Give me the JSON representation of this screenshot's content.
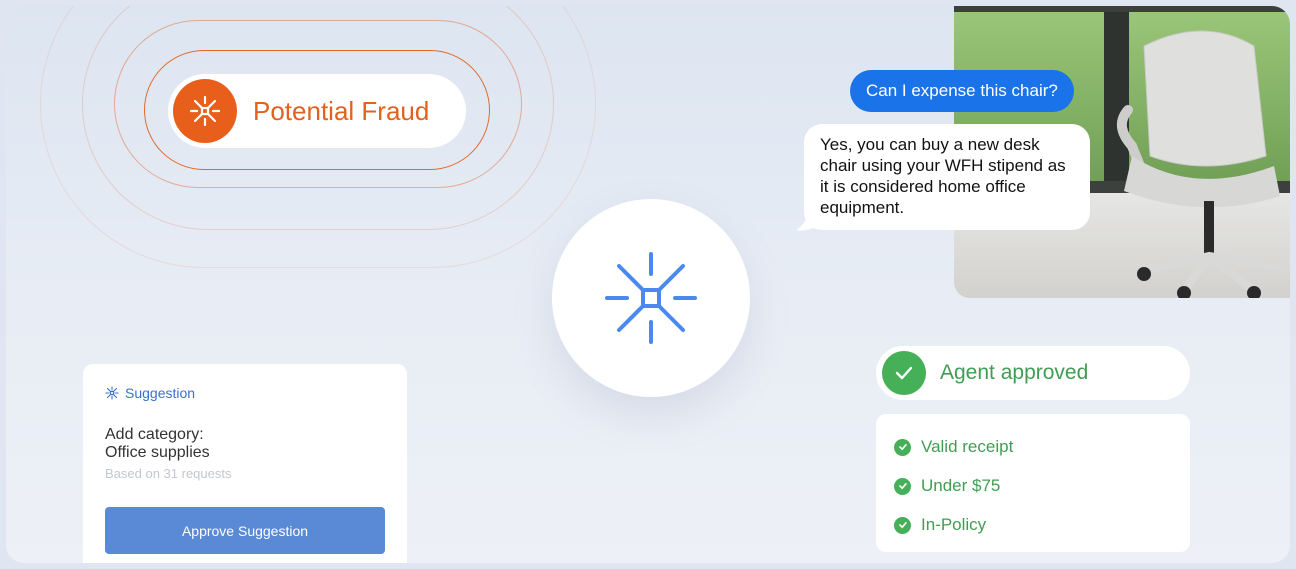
{
  "fraud": {
    "label": "Potential Fraud",
    "icon": "sparkle-icon",
    "color": "#e85f1c"
  },
  "center": {
    "icon": "sparkle-icon",
    "color": "#4a8af0"
  },
  "chat": {
    "user_message": "Can I expense this chair?",
    "agent_reply": "Yes, you can buy a new desk chair using your WFH stipend as it is considered home office equipment.",
    "photo_subject": "office chair photo"
  },
  "approval": {
    "status": "Agent approved",
    "checks": [
      "Valid receipt",
      "Under $75",
      "In-Policy"
    ],
    "color": "#45b058"
  },
  "suggestion": {
    "heading": "Suggestion",
    "line1": "Add category:",
    "line2": "Office supplies",
    "note": "Based on 31 requests",
    "button": "Approve Suggestion",
    "accent": "#5a89d6"
  }
}
